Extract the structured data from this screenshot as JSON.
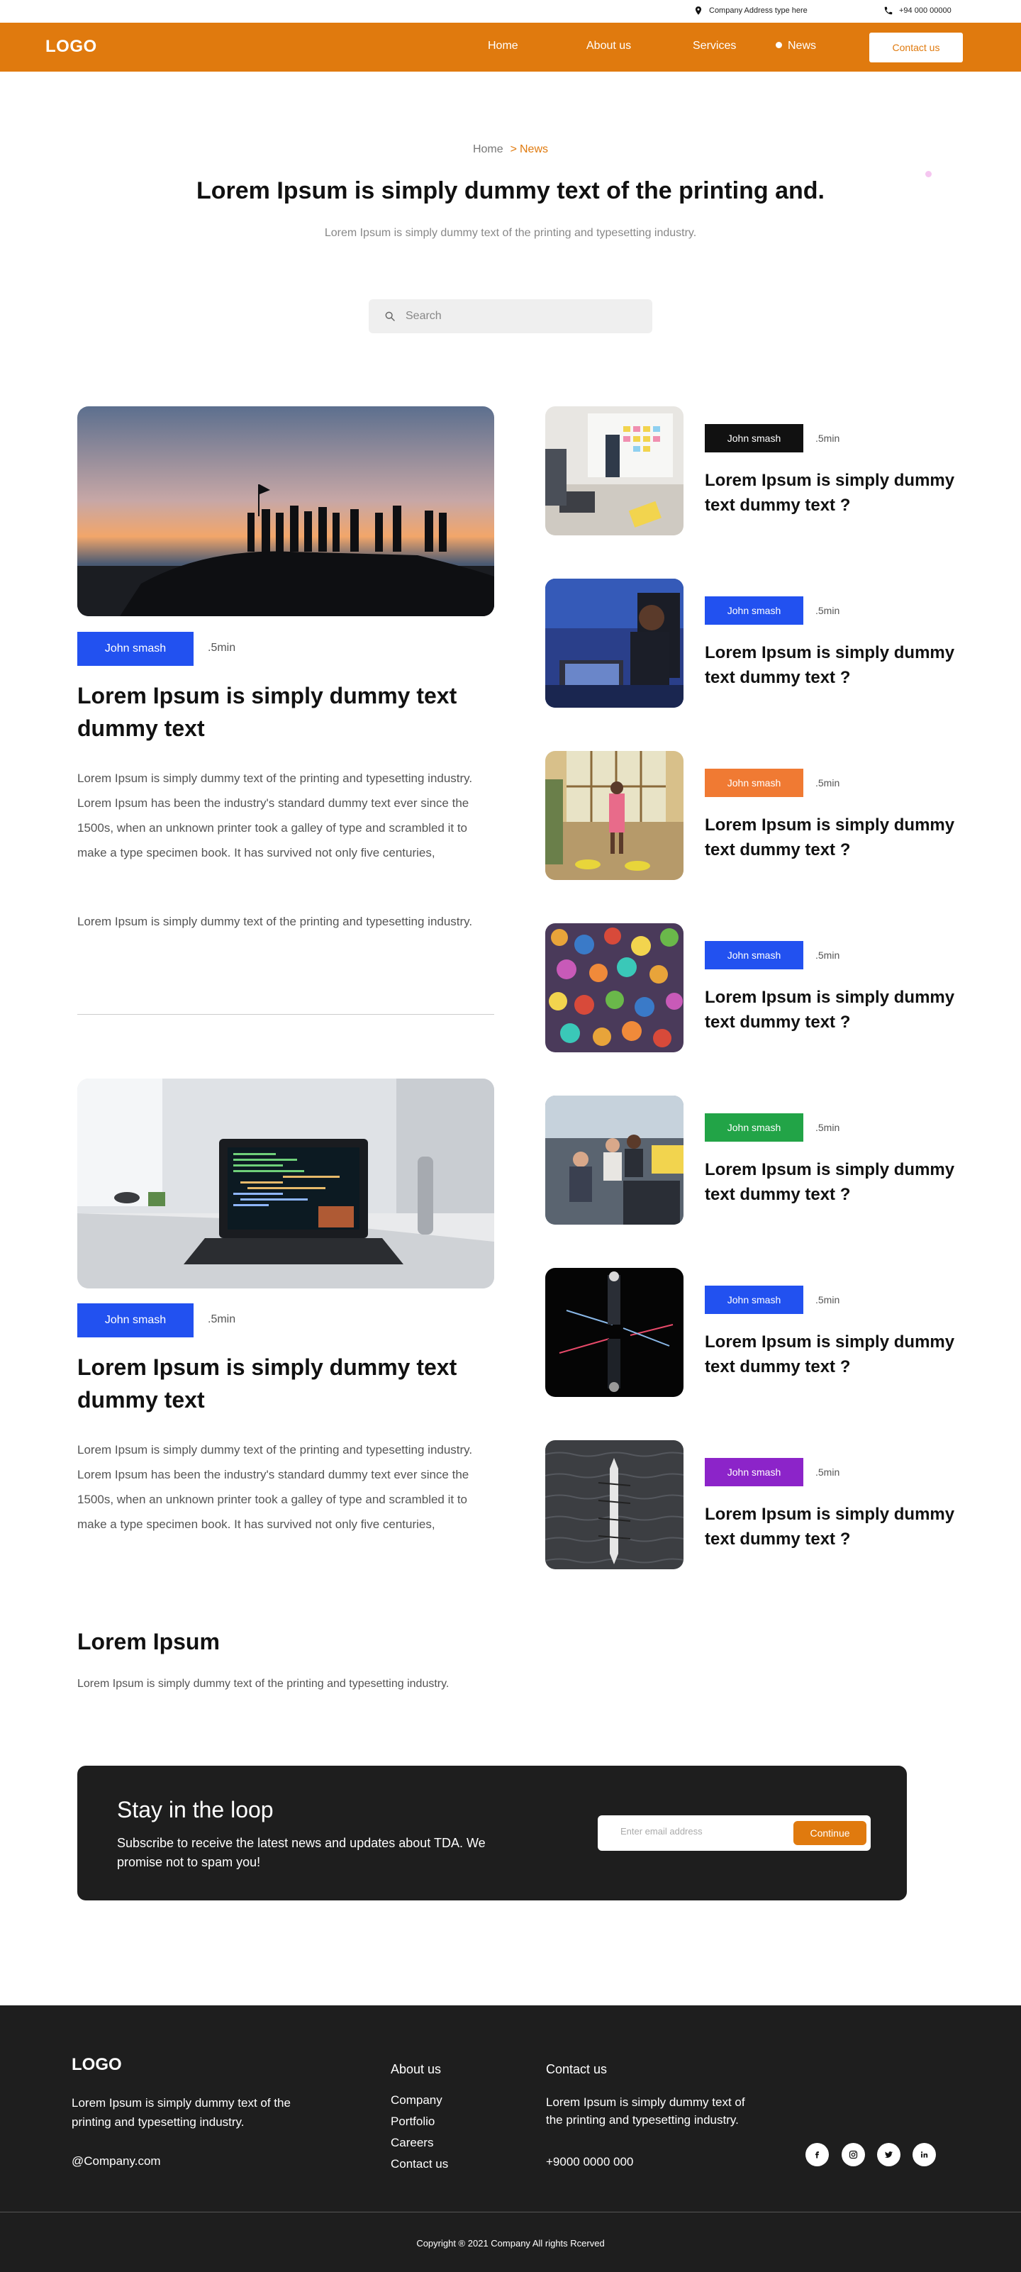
{
  "topbar": {
    "address": "Company Address type here",
    "phone": "+94 000 00000",
    "address_icon": "location-pin-icon",
    "phone_icon": "phone-icon"
  },
  "header": {
    "logo": "LOGO",
    "nav": [
      "Home",
      "About us",
      "Services",
      "News"
    ],
    "active_nav": "News",
    "contact_label": "Contact us",
    "accent": "#e07a0e"
  },
  "hero": {
    "breadcrumb_home": "Home",
    "breadcrumb_sep": ">",
    "breadcrumb_current": "News",
    "title": "Lorem Ipsum is simply dummy text of the printing and.",
    "subtitle": "Lorem Ipsum is simply dummy text of the printing and typesetting industry."
  },
  "search": {
    "placeholder": "Search",
    "icon": "search-icon"
  },
  "featured": [
    {
      "author": "John smash",
      "badge_color": "#2251f0",
      "readtime": ".5min",
      "title": "Lorem Ipsum is simply dummy text dummy text",
      "body1": "Lorem Ipsum is simply dummy text of the printing and typesetting industry. Lorem Ipsum has been the industry's standard dummy text ever since the 1500s, when an unknown printer took a galley of type and scrambled it to make a type specimen book. It has survived not only five centuries,",
      "body2": "Lorem Ipsum is simply dummy text of the printing and typesetting industry."
    },
    {
      "author": "John smash",
      "badge_color": "#2251f0",
      "readtime": ".5min",
      "title": "Lorem Ipsum is simply dummy text dummy text",
      "body1": "Lorem Ipsum is simply dummy text of the printing and typesetting industry. Lorem Ipsum has been the industry's standard dummy text ever since the 1500s, when an unknown printer took a galley of type and scrambled it to make a type specimen book. It has survived not only five centuries,"
    }
  ],
  "side_posts": [
    {
      "author": "John smash",
      "badge_color": "#111111",
      "readtime": ".5min",
      "title": "Lorem Ipsum is simply dummy text dummy text ?"
    },
    {
      "author": "John smash",
      "badge_color": "#2251f0",
      "readtime": ".5min",
      "title": "Lorem Ipsum is simply dummy text dummy text ?"
    },
    {
      "author": "John smash",
      "badge_color": "#f07a33",
      "readtime": ".5min",
      "title": "Lorem Ipsum is simply dummy text dummy text ?"
    },
    {
      "author": "John smash",
      "badge_color": "#2251f0",
      "readtime": ".5min",
      "title": "Lorem Ipsum is simply dummy text dummy text ?"
    },
    {
      "author": "John smash",
      "badge_color": "#22a447",
      "readtime": ".5min",
      "title": "Lorem Ipsum is simply dummy text dummy text ?"
    },
    {
      "author": "John smash",
      "badge_color": "#2251f0",
      "readtime": ".5min",
      "title": "Lorem Ipsum is simply dummy text dummy text ?"
    },
    {
      "author": "John smash",
      "badge_color": "#8c24c9",
      "readtime": ".5min",
      "title": "Lorem Ipsum is simply dummy text dummy text ?"
    }
  ],
  "lorem_section": {
    "title": "Lorem Ipsum",
    "body": "Lorem Ipsum is simply dummy text of the printing and typesetting industry."
  },
  "newsletter": {
    "title": "Stay in the loop",
    "body": "Subscribe to receive the latest news and updates about TDA. We promise not to spam you!",
    "placeholder": "Enter email address",
    "button": "Continue"
  },
  "footer": {
    "logo": "LOGO",
    "description": "Lorem Ipsum is simply dummy text of the printing and typesetting industry.",
    "handle": "@Company.com",
    "about_heading": "About us",
    "about_links": [
      "Company",
      "Portfolio",
      "Careers",
      "Contact us"
    ],
    "contact_heading": "Contact us",
    "contact_text": "Lorem Ipsum is simply dummy text of the printing and typesetting industry.",
    "phone": "+9000 0000 000",
    "social_icons": [
      "facebook-icon",
      "instagram-icon",
      "twitter-icon",
      "linkedin-icon"
    ],
    "copyright": "Copyright ® 2021 Company All rights Rcerved"
  }
}
